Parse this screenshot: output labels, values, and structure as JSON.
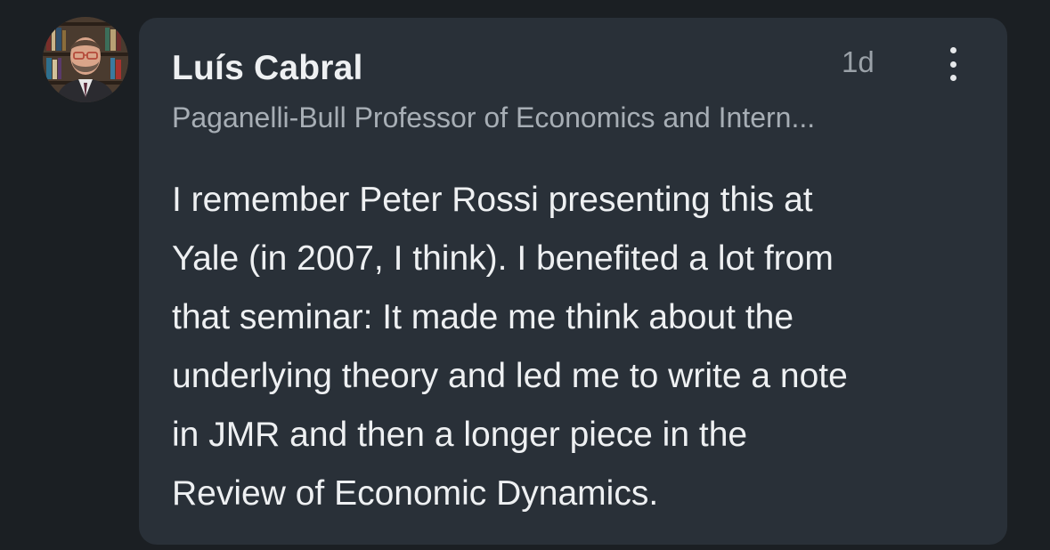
{
  "comment": {
    "author": {
      "name": "Luís Cabral",
      "headline": "Paganelli-Bull Professor of Economics and Intern...",
      "avatar_icon": "profile-photo"
    },
    "timestamp": "1d",
    "more_icon": "vertical-ellipsis-icon",
    "body_lines": [
      "I remember Peter Rossi presenting this at",
      "Yale (in 2007, I think). I benefited a lot from",
      "that seminar: It made me think about the",
      "underlying theory and led me to write a note",
      "in JMR and then a longer piece in the",
      "Review of Economic Dynamics."
    ]
  },
  "colors": {
    "page_background": "#1b1f23",
    "card_background": "#293038",
    "primary_text": "#eef0f2",
    "secondary_text": "#a7aeb5"
  }
}
